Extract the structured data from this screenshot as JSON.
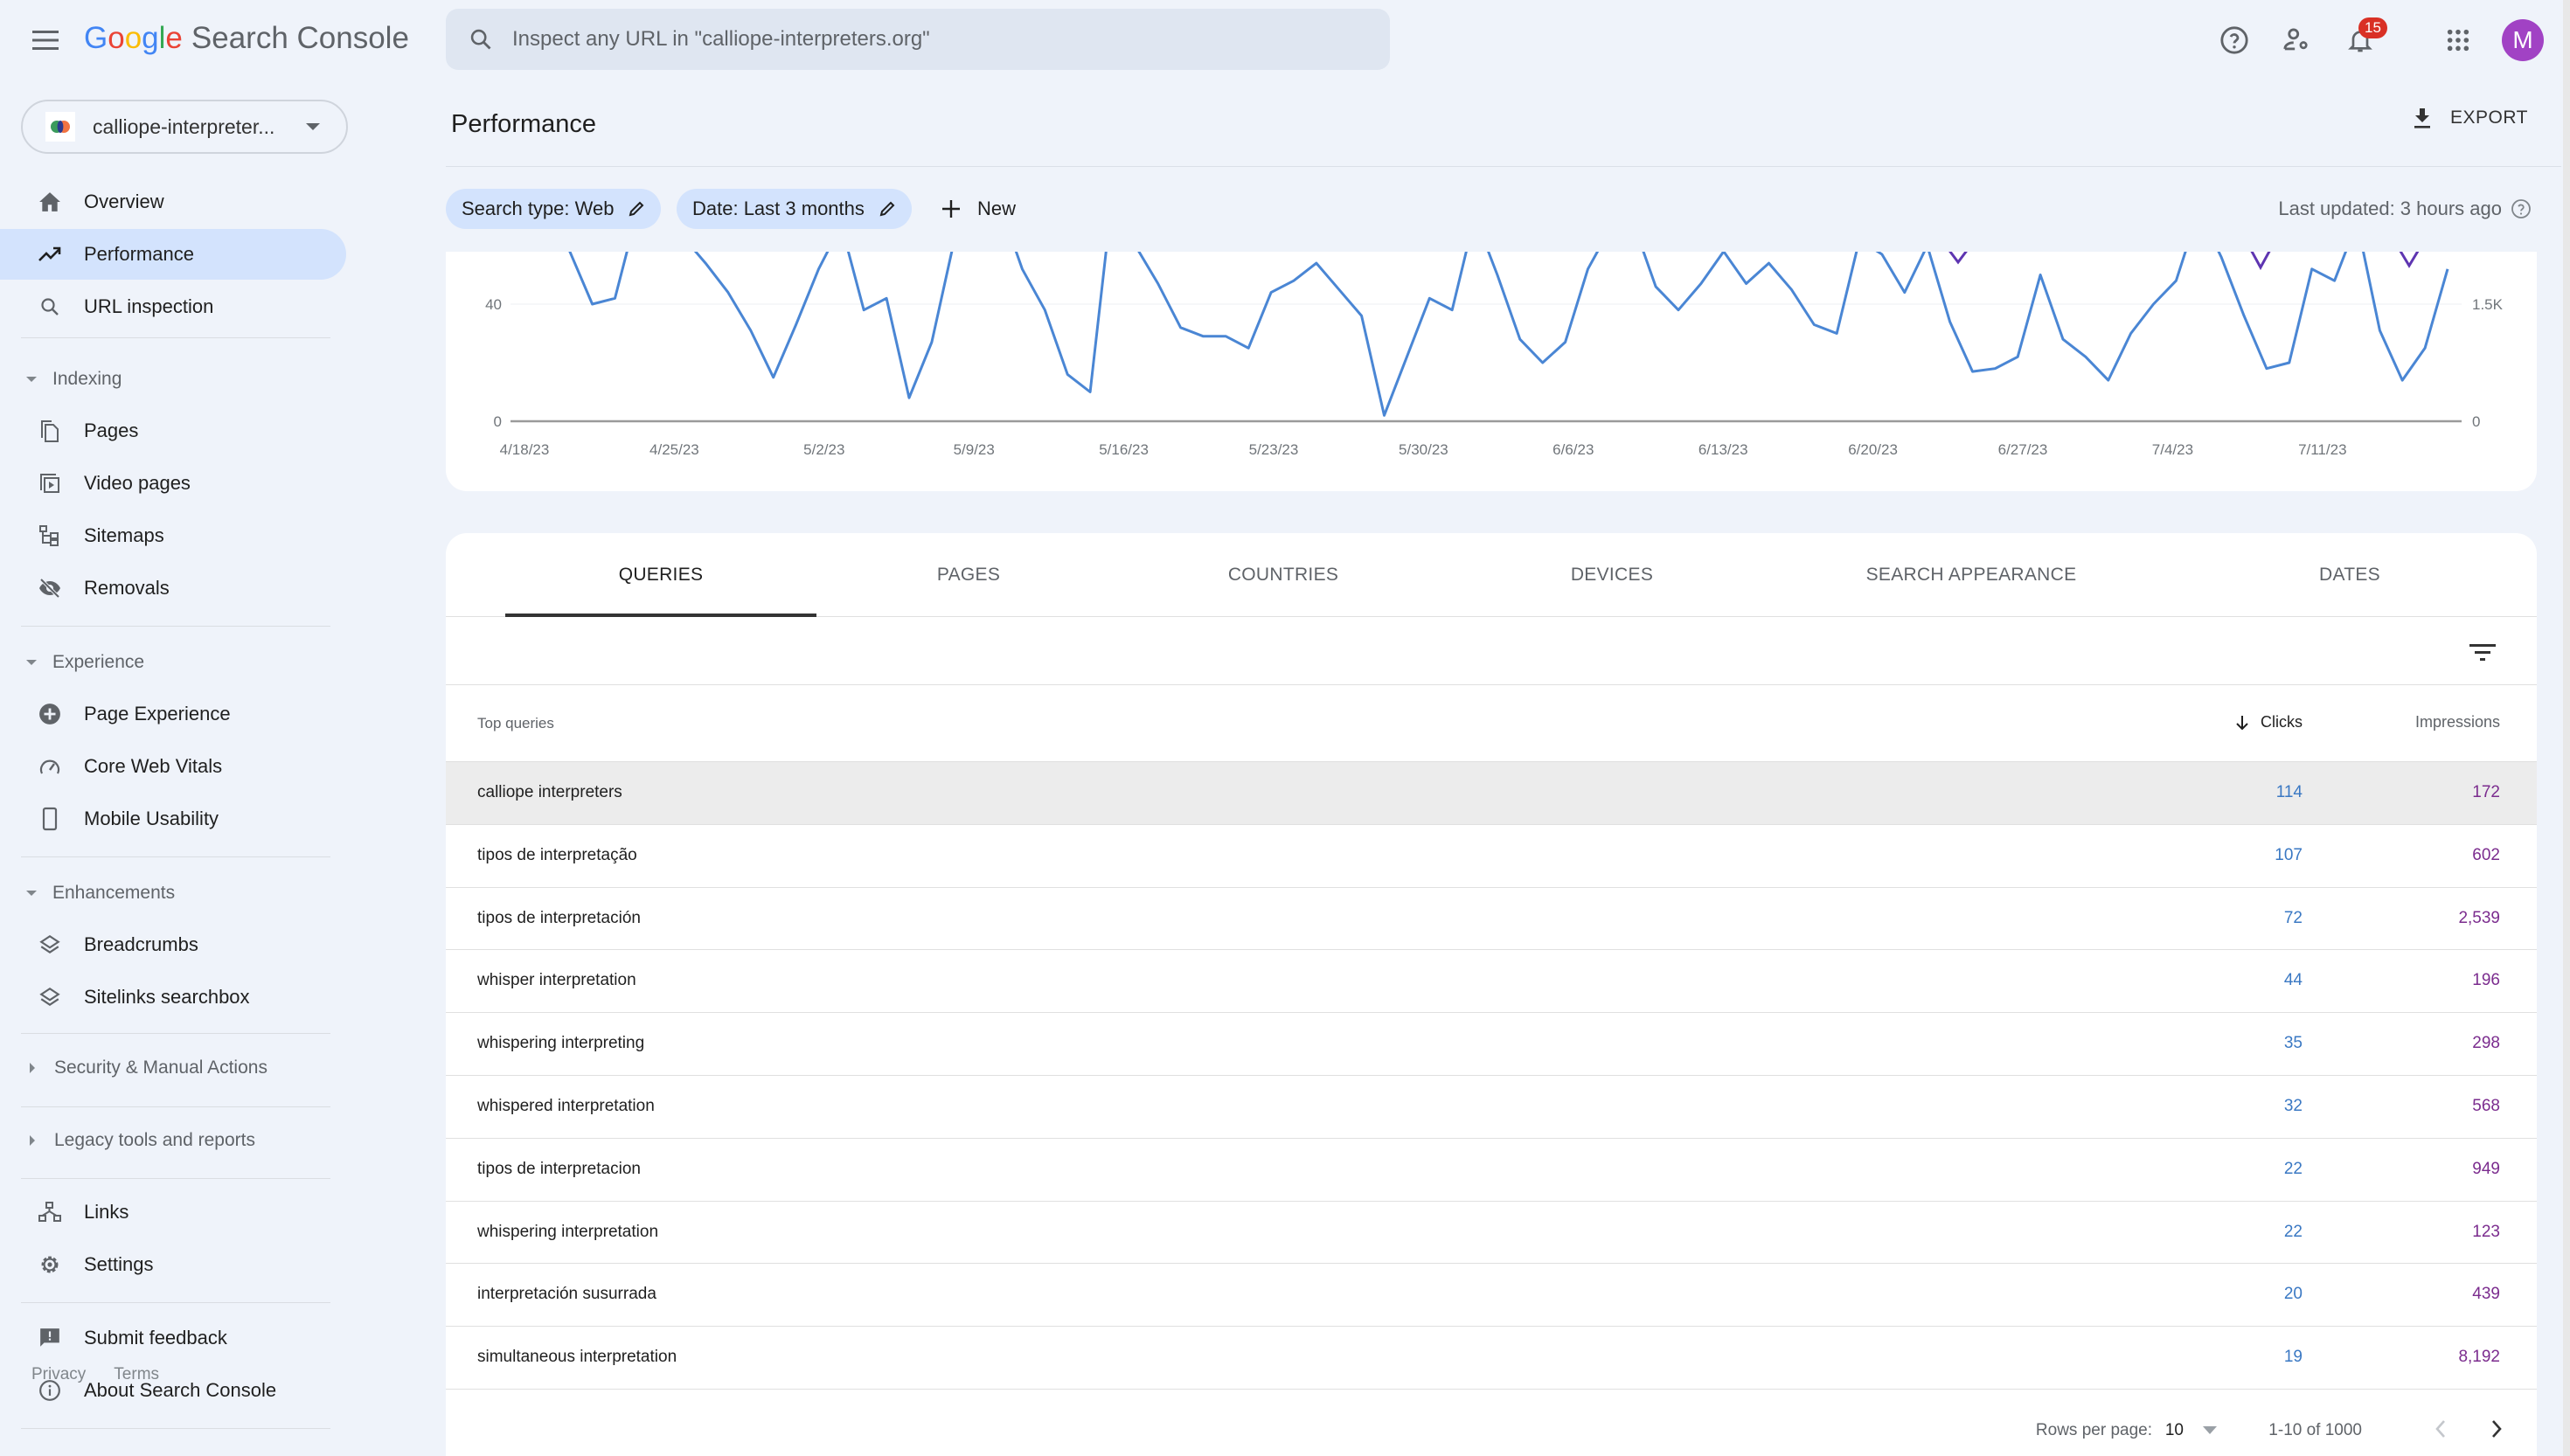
{
  "app": {
    "logo_google": [
      "G",
      "o",
      "o",
      "g",
      "l",
      "e"
    ],
    "logo_google_colors": [
      "#4285f4",
      "#ea4335",
      "#fbbc05",
      "#4285f4",
      "#34a853",
      "#ea4335"
    ],
    "logo_product": "Search Console"
  },
  "search": {
    "placeholder": "Inspect any URL in \"calliope-interpreters.org\"",
    "value": ""
  },
  "topbar": {
    "notifications_count": "15",
    "avatar_initial": "M",
    "avatar_color": "#a142c4"
  },
  "property": {
    "name": "calliope-interpreter..."
  },
  "sidebar": {
    "primary": [
      {
        "label": "Overview",
        "icon": "home-icon"
      },
      {
        "label": "Performance",
        "icon": "trending-up-icon",
        "active": true
      },
      {
        "label": "URL inspection",
        "icon": "search-icon"
      }
    ],
    "sections": [
      {
        "title": "Indexing",
        "expanded": true,
        "items": [
          {
            "label": "Pages",
            "icon": "pages-icon"
          },
          {
            "label": "Video pages",
            "icon": "video-pages-icon"
          },
          {
            "label": "Sitemaps",
            "icon": "sitemap-icon"
          },
          {
            "label": "Removals",
            "icon": "visibility-off-icon"
          }
        ]
      },
      {
        "title": "Experience",
        "expanded": true,
        "items": [
          {
            "label": "Page Experience",
            "icon": "plus-circle-icon"
          },
          {
            "label": "Core Web Vitals",
            "icon": "speed-gauge-icon"
          },
          {
            "label": "Mobile Usability",
            "icon": "smartphone-icon"
          }
        ]
      },
      {
        "title": "Enhancements",
        "expanded": true,
        "items": [
          {
            "label": "Breadcrumbs",
            "icon": "layers-icon"
          },
          {
            "label": "Sitelinks searchbox",
            "icon": "layers-icon"
          }
        ]
      },
      {
        "title": "Security & Manual Actions",
        "expanded": false,
        "items": []
      },
      {
        "title": "Legacy tools and reports",
        "expanded": false,
        "items": []
      }
    ],
    "bottom": [
      {
        "label": "Links",
        "icon": "links-icon"
      },
      {
        "label": "Settings",
        "icon": "gear-icon"
      },
      {
        "label": "Submit feedback",
        "icon": "feedback-icon"
      },
      {
        "label": "About Search Console",
        "icon": "info-icon"
      }
    ],
    "footer": {
      "privacy": "Privacy",
      "terms": "Terms"
    }
  },
  "main": {
    "title": "Performance",
    "export_label": "EXPORT",
    "filters": [
      {
        "label": "Search type: Web"
      },
      {
        "label": "Date: Last 3 months"
      }
    ],
    "new_label": "New",
    "last_updated": "Last updated: 3 hours ago"
  },
  "chart_data": {
    "type": "line",
    "title": "",
    "x_tick_labels": [
      "4/18/23",
      "4/25/23",
      "5/2/23",
      "5/9/23",
      "5/16/23",
      "5/23/23",
      "5/30/23",
      "6/6/23",
      "6/13/23",
      "6/20/23",
      "6/27/23",
      "7/4/23",
      "7/11/23"
    ],
    "left_axis": {
      "ticks": [
        "0",
        "40"
      ],
      "ylim": [
        0,
        80
      ],
      "series": "Clicks"
    },
    "right_axis": {
      "ticks": [
        "0",
        "1.5K"
      ],
      "ylim": [
        0,
        3000
      ],
      "series": "Impressions"
    },
    "grid": true,
    "series": [
      {
        "name": "Clicks",
        "color": "#4a86d4",
        "axis": "left",
        "values": [
          78,
          70,
          58,
          40,
          42,
          72,
          64,
          63,
          54,
          44,
          31,
          15,
          33,
          52,
          67,
          38,
          42,
          8,
          27,
          62,
          74,
          74,
          52,
          38,
          16,
          10,
          78,
          60,
          47,
          32,
          29,
          29,
          25,
          44,
          48,
          54,
          45,
          36,
          2,
          22,
          42,
          38,
          70,
          50,
          28,
          20,
          27,
          52,
          66,
          68,
          46,
          38,
          47,
          58,
          47,
          54,
          45,
          33,
          30,
          62,
          57,
          44,
          60,
          34,
          17,
          18,
          22,
          50,
          28,
          22,
          14,
          30,
          40,
          48,
          72,
          56,
          36,
          18,
          20,
          52,
          48,
          68,
          31,
          14,
          25,
          52
        ],
        "note": "approximate values; top of chart clipped (scrolled)"
      },
      {
        "name": "Impressions",
        "color": "#5e35b1",
        "axis": "right",
        "values": [],
        "note": "only partial visible peaks near top; mostly clipped"
      }
    ]
  },
  "table": {
    "tabs": [
      "QUERIES",
      "PAGES",
      "COUNTRIES",
      "DEVICES",
      "SEARCH APPEARANCE",
      "DATES"
    ],
    "active_tab": "QUERIES",
    "columns": {
      "query": "Top queries",
      "clicks": "Clicks",
      "impressions": "Impressions"
    },
    "rows": [
      {
        "query": "calliope interpreters",
        "clicks": "114",
        "impressions": "172"
      },
      {
        "query": "tipos de interpretação",
        "clicks": "107",
        "impressions": "602"
      },
      {
        "query": "tipos de interpretación",
        "clicks": "72",
        "impressions": "2,539"
      },
      {
        "query": "whisper interpretation",
        "clicks": "44",
        "impressions": "196"
      },
      {
        "query": "whispering interpreting",
        "clicks": "35",
        "impressions": "298"
      },
      {
        "query": "whispered interpretation",
        "clicks": "32",
        "impressions": "568"
      },
      {
        "query": "tipos de interpretacion",
        "clicks": "22",
        "impressions": "949"
      },
      {
        "query": "whispering interpretation",
        "clicks": "22",
        "impressions": "123"
      },
      {
        "query": "interpretación susurrada",
        "clicks": "20",
        "impressions": "439"
      },
      {
        "query": "simultaneous interpretation",
        "clicks": "19",
        "impressions": "8,192"
      }
    ],
    "pagination": {
      "rows_per_page_label": "Rows per page:",
      "rows_per_page": "10",
      "range": "1-10 of 1000"
    }
  }
}
